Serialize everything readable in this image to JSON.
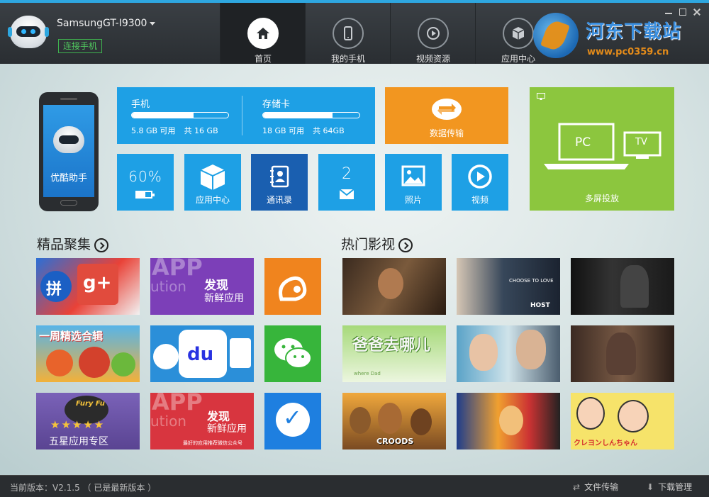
{
  "header": {
    "device_name": "SamsungGT-I9300",
    "connect_label": "连接手机",
    "tabs": [
      {
        "label": "首页",
        "icon": "home-icon"
      },
      {
        "label": "我的手机",
        "icon": "phone-icon"
      },
      {
        "label": "视频资源",
        "icon": "play-circle-icon"
      },
      {
        "label": "应用中心",
        "icon": "cube-icon"
      }
    ],
    "active_tab": 0,
    "watermark": {
      "title": "河东下载站",
      "url": "www.pc0359.cn"
    }
  },
  "device": {
    "screen_label": "优酷助手"
  },
  "storage": {
    "phone": {
      "name": "手机",
      "available": "5.8 GB 可用",
      "total": "共 16 GB",
      "used_fraction": 0.64
    },
    "card": {
      "name": "存储卡",
      "available": "18 GB 可用",
      "total": "共 64GB",
      "used_fraction": 0.72
    }
  },
  "tiles": {
    "data_transfer": "数据传输",
    "multi_screen": "多屏投放",
    "multi_screen_pc": "PC",
    "multi_screen_tv": "TV",
    "battery_pct": "60%",
    "battery_level": 0.6,
    "app_center": "应用中心",
    "contacts": "通讯录",
    "sms_number": "2",
    "photos": "照片",
    "video": "视频"
  },
  "sections": {
    "apps_title": "精品聚集",
    "videos_title": "热门影视"
  },
  "app_cards": [
    {
      "text": "拼",
      "text2": "g+",
      "name": "google-apps"
    },
    {
      "text": "发现",
      "text2": "新鲜应用",
      "bg_text": "APP",
      "bg_text2": "ution",
      "name": "discover-apps-1"
    },
    {
      "text": "UC",
      "name": "uc-browser"
    },
    {
      "text": "一周精选合辑",
      "name": "weekly-picks"
    },
    {
      "text": "du",
      "name": "baidu-apps"
    },
    {
      "text": "WeChat",
      "name": "wechat"
    },
    {
      "text": "五星应用专区",
      "badge": "Fury Fu",
      "name": "five-star-apps"
    },
    {
      "text": "发现",
      "text2": "新鲜应用",
      "bg_text": "APP",
      "bg_text2": "ution",
      "caption": "最好的应用推荐微信公众号",
      "name": "discover-apps-2"
    },
    {
      "text": "✓",
      "name": "task-check-app"
    }
  ],
  "video_cards": [
    {
      "name": "movie-1"
    },
    {
      "name": "movie-host",
      "caption": "CHOOSE TO LOVE",
      "caption2": "HOST"
    },
    {
      "name": "movie-3"
    },
    {
      "name": "show-baba",
      "caption": "爸爸去哪儿",
      "caption2": "where Dad"
    },
    {
      "name": "movie-5"
    },
    {
      "name": "show-7"
    },
    {
      "name": "movie-croods",
      "caption": "CROODS"
    },
    {
      "name": "anime-naruto"
    },
    {
      "name": "anime-shinchan",
      "caption": "クレヨンしんちゃん"
    }
  ],
  "statusbar": {
    "version": "当前版本：V2.1.5 （ 已是最新版本 ）",
    "file_transfer": "文件传输",
    "download_manager": "下载管理"
  }
}
